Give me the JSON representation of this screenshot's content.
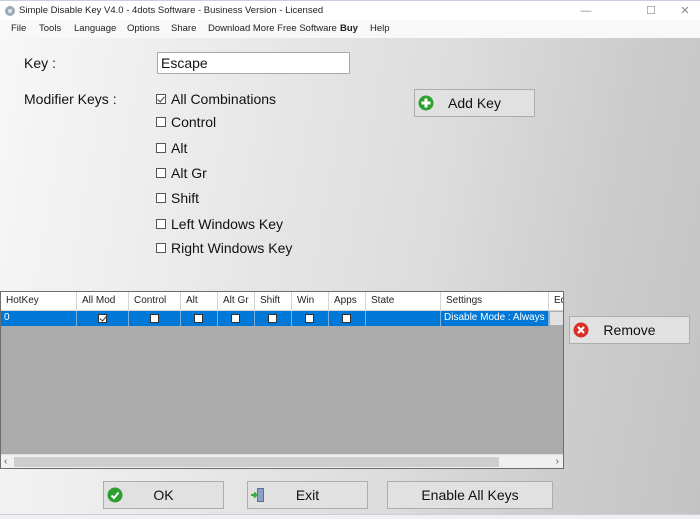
{
  "window": {
    "title": "Simple Disable Key V4.0 - 4dots Software - Business Version - Licensed",
    "controls": {
      "minimize": "—",
      "maximize": "☐",
      "close": "✕"
    }
  },
  "menu": [
    {
      "label": "File"
    },
    {
      "label": "Tools"
    },
    {
      "label": "Language"
    },
    {
      "label": "Options"
    },
    {
      "label": "Share"
    },
    {
      "label": "Download More Free Software"
    },
    {
      "label": "Buy"
    },
    {
      "label": "Help"
    }
  ],
  "form": {
    "key_label": "Key :",
    "key_value": "Escape",
    "modifier_label": "Modifier Keys :",
    "modifiers": [
      {
        "label": "All Combinations",
        "checked": true
      },
      {
        "label": "Control",
        "checked": false
      },
      {
        "label": "Alt",
        "checked": false
      },
      {
        "label": "Alt Gr",
        "checked": false
      },
      {
        "label": "Shift",
        "checked": false
      },
      {
        "label": "Left Windows Key",
        "checked": false
      },
      {
        "label": "Right Windows Key",
        "checked": false
      }
    ],
    "add_key_label": "Add Key",
    "remove_label": "Remove"
  },
  "grid": {
    "columns": [
      "HotKey",
      "All Mod",
      "Control",
      "Alt",
      "Alt Gr",
      "Shift",
      "Win",
      "Apps",
      "State",
      "Settings",
      "Ed"
    ],
    "rows": [
      {
        "hotkey": "0",
        "all_mod": true,
        "control": false,
        "alt": false,
        "alt_gr": false,
        "shift": false,
        "win": false,
        "apps": false,
        "state": "",
        "settings": "Disable Mode : Always",
        "ed": ""
      }
    ]
  },
  "buttons": {
    "ok": "OK",
    "exit": "Exit",
    "enable_all": "Enable All Keys"
  },
  "colors": {
    "selection": "#0078d7",
    "ok_icon": "#2e9e2e",
    "remove_icon": "#d9302a",
    "add_icon": "#2ea02e"
  }
}
